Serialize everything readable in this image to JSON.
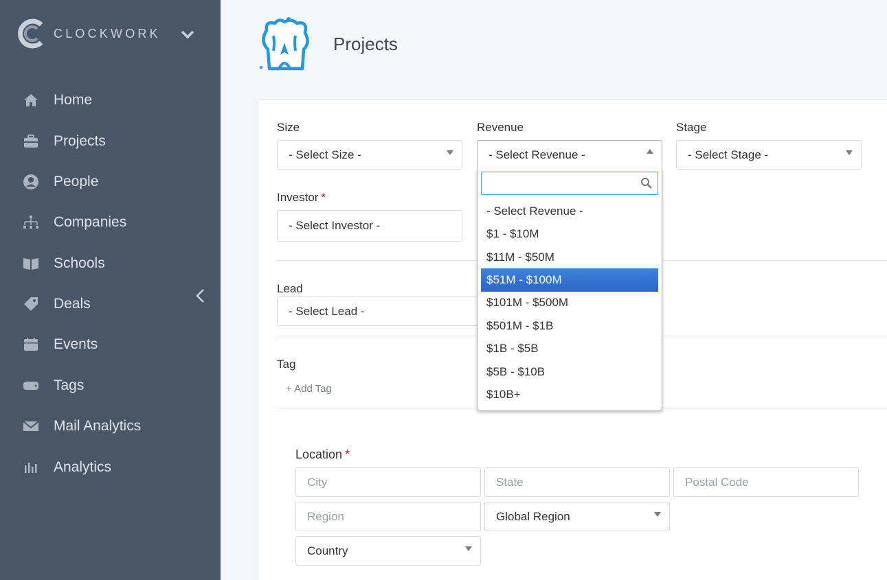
{
  "brand": {
    "name": "CLOCKWORK"
  },
  "sidebar": {
    "items": [
      {
        "label": "Home",
        "icon": "home-icon"
      },
      {
        "label": "Projects",
        "icon": "briefcase-icon"
      },
      {
        "label": "People",
        "icon": "person-icon"
      },
      {
        "label": "Companies",
        "icon": "org-chart-icon"
      },
      {
        "label": "Schools",
        "icon": "book-icon"
      },
      {
        "label": "Deals",
        "icon": "tag-icon"
      },
      {
        "label": "Events",
        "icon": "calendar-icon"
      },
      {
        "label": "Tags",
        "icon": "label-icon"
      },
      {
        "label": "Mail Analytics",
        "icon": "mail-icon"
      },
      {
        "label": "Analytics",
        "icon": "bar-chart-icon"
      }
    ]
  },
  "header": {
    "title": "Projects"
  },
  "form": {
    "size": {
      "label": "Size",
      "value": "- Select Size -"
    },
    "revenue": {
      "label": "Revenue",
      "value": "- Select Revenue -"
    },
    "stage": {
      "label": "Stage",
      "value": "- Select Stage -"
    },
    "investor": {
      "label": "Investor",
      "required": "*",
      "value": "- Select Investor -"
    },
    "lead": {
      "label": "Lead",
      "value": "- Select Lead -"
    },
    "tag": {
      "label": "Tag",
      "add": "+ Add Tag"
    },
    "location": {
      "label": "Location",
      "required": "*",
      "city_placeholder": "City",
      "state_placeholder": "State",
      "postal_placeholder": "Postal Code",
      "region_placeholder": "Region",
      "global_region": "Global Region",
      "country": "Country"
    }
  },
  "revenue_dropdown": {
    "search_value": "",
    "options": [
      "- Select Revenue -",
      "$1 - $10M",
      "$11M - $50M",
      "$51M - $100M",
      "$101M - $500M",
      "$501M - $1B",
      "$1B - $5B",
      "$5B - $10B",
      "$10B+"
    ],
    "highlighted": "$51M - $100M"
  },
  "colors": {
    "sidebar_bg": "#495666",
    "highlight": "#2f6fce",
    "required": "#b32020",
    "logo_blue": "#1e9be3"
  }
}
